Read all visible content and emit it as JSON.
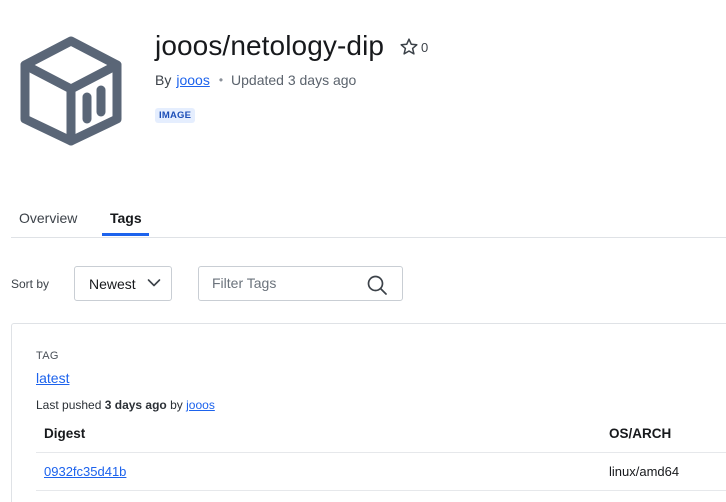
{
  "repo": {
    "title": "jooos/netology-dip",
    "star_count": "0",
    "by_label": "By",
    "owner": "jooos",
    "separator": "•",
    "updated": "Updated 3 days ago",
    "badge": "IMAGE"
  },
  "tabs": [
    {
      "label": "Overview",
      "active": false
    },
    {
      "label": "Tags",
      "active": true
    }
  ],
  "controls": {
    "sort_label": "Sort by",
    "sort_value": "Newest",
    "filter_placeholder": "Filter Tags",
    "filter_value": ""
  },
  "tag": {
    "caption": "TAG",
    "name": "latest",
    "pushed_prefix": "Last pushed",
    "pushed_when": "3 days ago",
    "pushed_by_word": "by",
    "pushed_by": "jooos",
    "columns": [
      "Digest",
      "OS/ARCH"
    ],
    "rows": [
      {
        "digest": "0932fc35d41b",
        "os_arch": "linux/amd64"
      }
    ]
  },
  "colors": {
    "accent": "#1d63ed",
    "logo": "#5a6677",
    "badge_bg": "#e5eefe"
  }
}
